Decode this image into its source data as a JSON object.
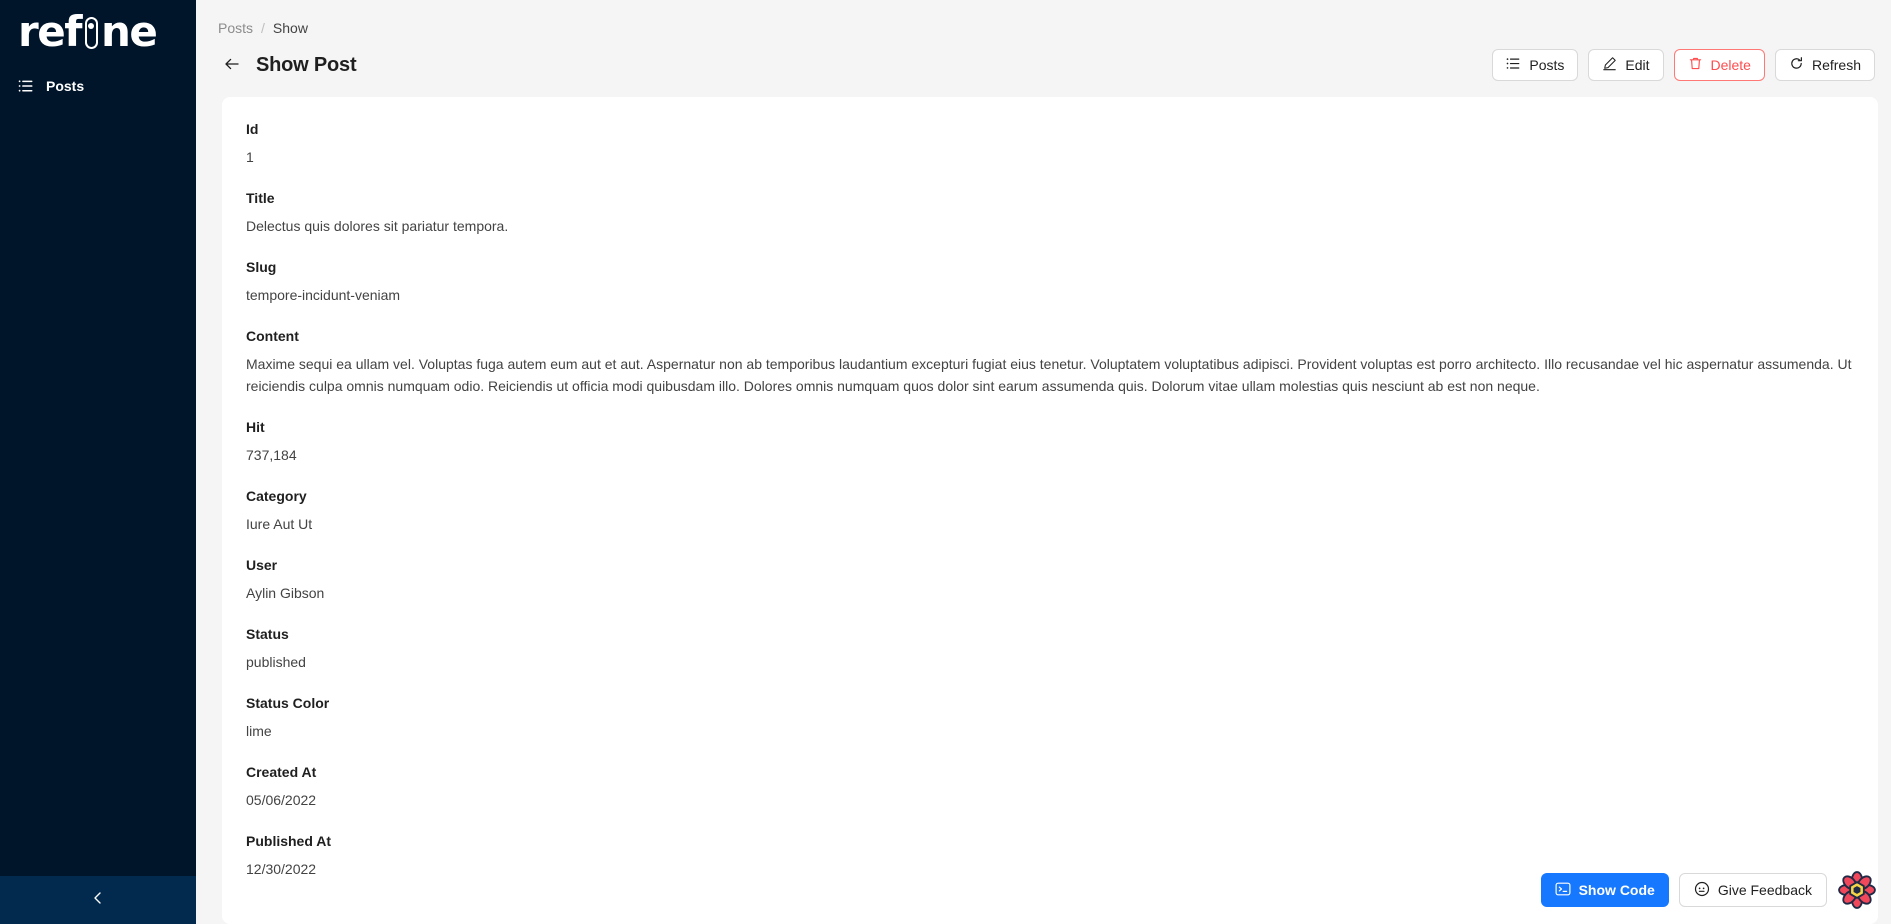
{
  "sidebar": {
    "logo_text_before": "ref",
    "logo_text_after": "ne",
    "logo_full": "refine",
    "items": [
      {
        "label": "Posts",
        "icon": "list-icon",
        "active": true
      }
    ],
    "collapse_icon": "chevron-left-icon"
  },
  "breadcrumb": {
    "items": [
      "Posts",
      "Show"
    ],
    "separator": "/"
  },
  "header": {
    "back_icon": "arrow-left-icon",
    "title": "Show Post",
    "actions": [
      {
        "label": "Posts",
        "icon": "list-icon",
        "variant": "default"
      },
      {
        "label": "Edit",
        "icon": "pencil-icon",
        "variant": "default"
      },
      {
        "label": "Delete",
        "icon": "trash-icon",
        "variant": "danger"
      },
      {
        "label": "Refresh",
        "icon": "refresh-icon",
        "variant": "default"
      }
    ]
  },
  "record": {
    "fields": [
      {
        "label": "Id",
        "value": "1"
      },
      {
        "label": "Title",
        "value": "Delectus quis dolores sit pariatur tempora."
      },
      {
        "label": "Slug",
        "value": "tempore-incidunt-veniam"
      },
      {
        "label": "Content",
        "value": "Maxime sequi ea ullam vel. Voluptas fuga autem eum aut et aut. Aspernatur non ab temporibus laudantium excepturi fugiat eius tenetur. Voluptatem voluptatibus adipisci. Provident voluptas est porro architecto. Illo recusandae vel hic aspernatur assumenda. Ut reiciendis culpa omnis numquam odio. Reiciendis ut officia modi quibusdam illo. Dolores omnis numquam quos dolor sint earum assumenda quis. Dolorum vitae ullam molestias quis nesciunt ab est non neque."
      },
      {
        "label": "Hit",
        "value": "737,184"
      },
      {
        "label": "Category",
        "value": "Iure Aut Ut"
      },
      {
        "label": "User",
        "value": "Aylin Gibson"
      },
      {
        "label": "Status",
        "value": "published"
      },
      {
        "label": "Status Color",
        "value": "lime"
      },
      {
        "label": "Created At",
        "value": "05/06/2022"
      },
      {
        "label": "Published At",
        "value": "12/30/2022"
      }
    ]
  },
  "floating": {
    "show_code_label": "Show Code",
    "show_code_icon": "terminal-icon",
    "feedback_label": "Give Feedback",
    "feedback_icon": "chat-icon",
    "mascot_icon": "refine-flower-logo"
  },
  "colors": {
    "sidebar_bg": "#001529",
    "collapse_bg": "#012A4E",
    "page_bg": "#F5F5F5",
    "card_bg": "#FFFFFF",
    "primary": "#1677FF",
    "danger": "#FF4D4F",
    "mascot_red": "#F0475B",
    "mascot_yellow": "#F5D546"
  }
}
